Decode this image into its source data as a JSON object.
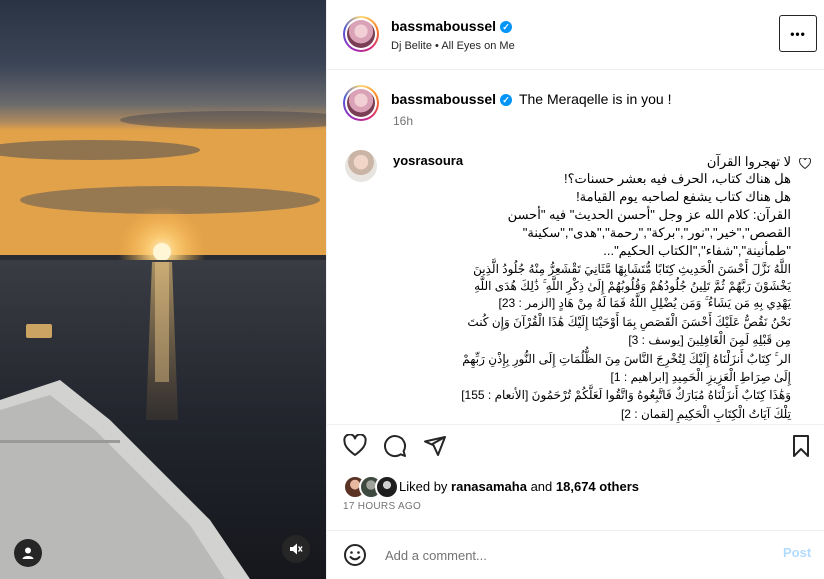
{
  "post": {
    "author": "bassmaboussel",
    "music": "Dj Belite • All Eyes on Me",
    "more_label": "•••",
    "caption": "The Meraqelle is in you !",
    "time_ago": "16h"
  },
  "comment": {
    "user": "yosrasoura",
    "lines": [
      "لا تهجروا القرآن",
      "هل هناك كتاب، الحرف فيه بعشر حسنات؟!",
      "هل هناك كتاب يشفع لصاحبه يوم القيامة!",
      "القرآن: كلام الله عز وجل \"أحسن الحديث\" فيه \"أحسن",
      "القصص\",\"خير\",\"نور\",\"بركة\",\"رحمة\",\"هدى\",\"سكينة\"",
      "\"طمأنينة\",\"شفاء\",\"الكتاب الحكيم\"...",
      "اللَّهُ نَزَّلَ أَحْسَنَ الْحَدِيثِ كِتَابًا مُّتَشَابِهًا مَّثَانِيَ تَقْشَعِرُّ مِنْهُ جُلُودُ الَّذِينَ",
      "يَخْشَوْنَ رَبَّهُمْ ثُمَّ تَلِينُ جُلُودُهُمْ وَقُلُوبُهُمْ إِلَىٰ ذِكْرِ اللَّهِ ۚ ذَٰلِكَ هُدَى اللَّهِ",
      "يَهْدِي بِهِ مَن يَشَاءُ ۚ وَمَن يُضْلِلِ اللَّهُ فَمَا لَهُ مِنْ هَادٍ [الزمر : 23]",
      "نَحْنُ نَقُصُّ عَلَيْكَ أَحْسَنَ الْقَصَصِ بِمَا أَوْحَيْنَا إِلَيْكَ هَٰذَا الْقُرْآنَ وَإِن كُنتَ",
      "مِن قَبْلِهِ لَمِنَ الْغَافِلِينَ [يوسف : 3]",
      "الر ۚ كِتَابٌ أَنزَلْنَاهُ إِلَيْكَ لِتُخْرِجَ النَّاسَ مِنَ الظُّلُمَاتِ إِلَى النُّورِ بِإِذْنِ رَبِّهِمْ",
      "إِلَىٰ صِرَاطِ الْعَزِيزِ الْحَمِيدِ [ابراهيم : 1]",
      "وَهَٰذَا كِتَابٌ أَنزَلْنَاهُ مُبَارَكٌ فَاتَّبِعُوهُ وَاتَّقُوا لَعَلَّكُمْ تُرْحَمُونَ [الأنعام : 155]",
      "تِلْكَ آيَاتُ الْكِتَابِ الْحَكِيمِ [لقمان : 2]"
    ]
  },
  "likes": {
    "prefix": "Liked by",
    "user": "ranasamaha",
    "middle": "and",
    "count": "18,674 others"
  },
  "post_age": "17 HOURS AGO",
  "add_comment": {
    "placeholder": "Add a comment...",
    "post_label": "Post"
  },
  "icons": [
    "heart-icon",
    "comment-icon",
    "share-icon",
    "bookmark-icon",
    "emoji-icon",
    "user-tag-icon",
    "mute-icon",
    "verified-badge-icon",
    "more-options-icon"
  ],
  "colors": {
    "accent": "#0095f6",
    "post_disabled": "#b3dbff",
    "muted_text": "#737373"
  }
}
